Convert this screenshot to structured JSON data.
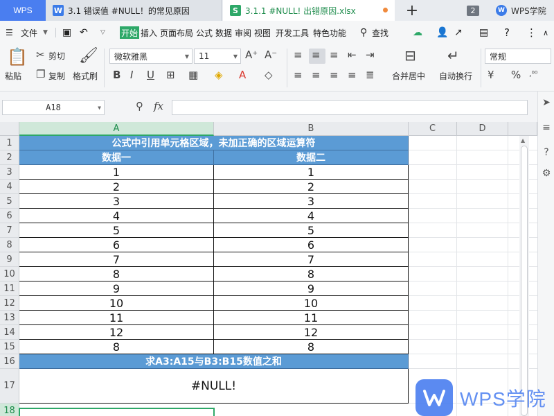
{
  "titlebar": {
    "wps_tab": "WPS",
    "doc_tab": {
      "icon": "W",
      "title": "3.1 错误值 #NULL！的常见原因"
    },
    "xls_tab": {
      "icon": "S",
      "title": "3.1.1 #NULL! 出错原因.xlsx"
    },
    "new_tab": "+",
    "window_count": "2",
    "account_name": "WPS学院",
    "account_logo": "W"
  },
  "menu": {
    "file": "文件",
    "tabs": [
      "开始",
      "插入",
      "页面布局",
      "公式",
      "数据",
      "审阅",
      "视图",
      "开发工具",
      "特色功能"
    ],
    "search": "查找"
  },
  "ribbon": {
    "paste": "粘贴",
    "cut": "剪切",
    "copy": "复制",
    "format_painter": "格式刷",
    "font_name": "微软雅黑",
    "font_size": "11",
    "merge_center": "合并居中",
    "wrap_text": "自动换行",
    "number_format": "常规"
  },
  "formula_bar": {
    "name_box": "A18",
    "fx": "fx",
    "formula": ""
  },
  "grid": {
    "columns": [
      "A",
      "B",
      "C",
      "D"
    ],
    "rows": [
      "1",
      "2",
      "3",
      "4",
      "5",
      "6",
      "7",
      "8",
      "9",
      "10",
      "11",
      "12",
      "13",
      "14",
      "15",
      "16",
      "17",
      "18"
    ],
    "title": "公式中引用单元格区域，未加正确的区域运算符",
    "header_a": "数据一",
    "header_b": "数据二",
    "data_a": [
      "1",
      "2",
      "3",
      "4",
      "5",
      "6",
      "7",
      "8",
      "9",
      "10",
      "11",
      "12",
      "8"
    ],
    "data_b": [
      "1",
      "2",
      "3",
      "4",
      "5",
      "6",
      "7",
      "8",
      "9",
      "10",
      "11",
      "12",
      "8"
    ],
    "instruction": "求A3:A15与B3:B15数值之和",
    "result": "#NULL!"
  },
  "watermark": {
    "text": "WPS学院"
  },
  "colors": {
    "accent_green": "#2ea868",
    "header_blue": "#5b9bd5",
    "wps_blue": "#4a7ef0"
  }
}
